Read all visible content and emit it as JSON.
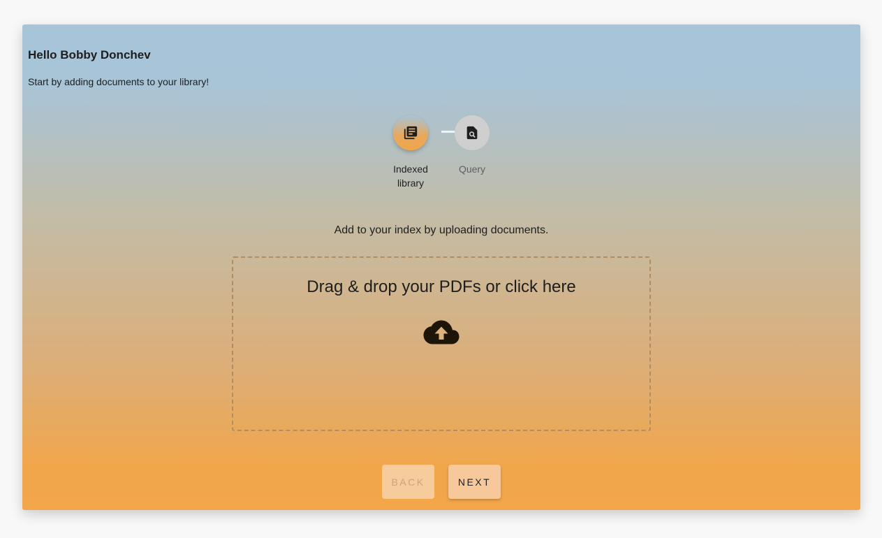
{
  "header": {
    "greeting": "Hello Bobby Donchev",
    "subtitle": "Start by adding documents to your library!"
  },
  "stepper": {
    "steps": [
      {
        "label": "Indexed library",
        "icon": "library-books-icon",
        "state": "active"
      },
      {
        "label": "Query",
        "icon": "document-search-icon",
        "state": "inactive"
      }
    ]
  },
  "upload": {
    "instruction": "Add to your index by uploading documents.",
    "dropzone_text": "Drag & drop your PDFs or click here",
    "icon": "cloud-upload-icon"
  },
  "navigation": {
    "back_label": "Back",
    "next_label": "Next"
  },
  "colors": {
    "gradient_top": "#a8c4d8",
    "gradient_bottom": "#f3a64a"
  }
}
